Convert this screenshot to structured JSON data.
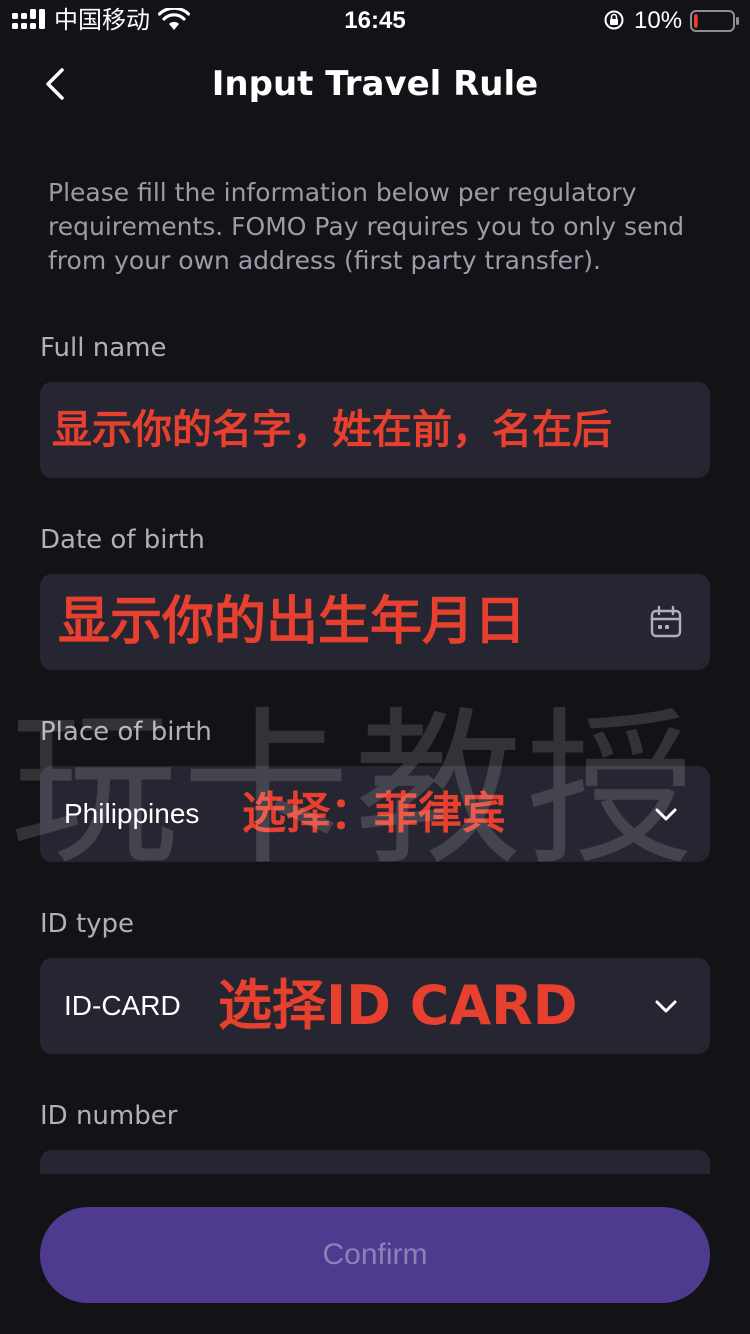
{
  "status_bar": {
    "carrier": "中国移动",
    "time": "16:45",
    "battery_percent": "10%",
    "battery_level": 0.1,
    "battery_color": "#e8402e"
  },
  "nav": {
    "title": "Input Travel Rule",
    "back_icon": "chevron-left-icon"
  },
  "intro": "Please fill the information below per regulatory requirements. FOMO Pay requires you to only send from your own address (first party transfer).",
  "form": {
    "full_name": {
      "label": "Full name",
      "value": "",
      "annotation": "显示你的名字，姓在前，名在后"
    },
    "date_of_birth": {
      "label": "Date of birth",
      "value": "",
      "annotation": "显示你的出生年月日",
      "icon": "calendar-icon"
    },
    "place_of_birth": {
      "label": "Place of birth",
      "value": "Philippines",
      "annotation": "选择：菲律宾",
      "icon": "chevron-down-icon"
    },
    "id_type": {
      "label": "ID type",
      "value": "ID-CARD",
      "annotation": "选择ID CARD",
      "icon": "chevron-down-icon"
    },
    "id_number": {
      "label": "ID number",
      "value": ""
    }
  },
  "watermark": "玩卡教授",
  "confirm_label": "Confirm",
  "colors": {
    "background": "#121217",
    "field_bg": "#262633",
    "annotation_red": "#e8402e",
    "button_bg": "#4e3a8e",
    "button_text": "#8e80b6"
  }
}
